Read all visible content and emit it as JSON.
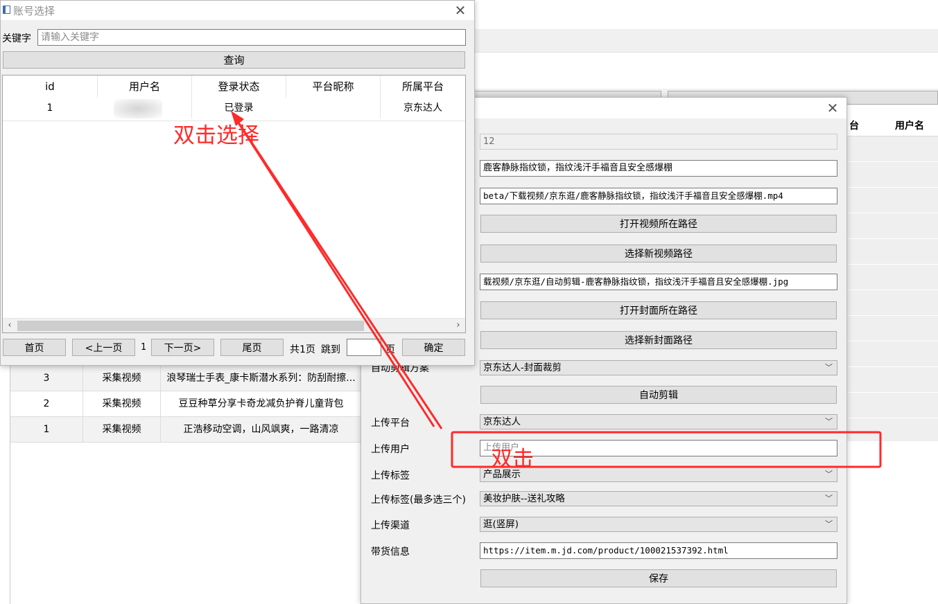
{
  "account_dialog": {
    "title": "账号选择",
    "keyword_label": "关键字",
    "keyword_placeholder": "请输入关键字",
    "query_button": "查询",
    "table_headers": [
      "id",
      "用户名",
      "登录状态",
      "平台昵称",
      "所属平台"
    ],
    "rows": [
      {
        "id": "1",
        "username": "",
        "login_status": "已登录",
        "nickname": "",
        "platform": "京东达人"
      }
    ],
    "pager": {
      "first": "首页",
      "prev": "<上一页",
      "current_page": "1",
      "next": "下一页>",
      "last": "尾页",
      "total": "共1页",
      "jump_to": "跳到",
      "page_unit": "页",
      "confirm": "确定"
    }
  },
  "background_table": {
    "header_partial": "台",
    "header_username": "用户名",
    "rows": [
      {
        "id": "3",
        "type": "采集视频",
        "title": "浪琴瑞士手表_康卡斯潜水系列：防刮耐擦..."
      },
      {
        "id": "2",
        "type": "采集视频",
        "title": "豆豆种草分享卡奇龙减负护脊儿童背包"
      },
      {
        "id": "1",
        "type": "采集视频",
        "title": "正浩移动空调，山风飒爽，一路清凉"
      }
    ]
  },
  "edit_dialog": {
    "id_value": "12",
    "title_value": "鹿客静脉指纹锁，指纹浅汗手福音且安全感爆棚",
    "video_path": "beta/下载视频/京东逛/鹿客静脉指纹锁，指纹浅汗手福音且安全感爆棚.mp4",
    "open_video_path_button": "打开视频所在路径",
    "select_video_path_button": "选择新视频路径",
    "cover_path": "载视频/京东逛/自动剪辑-鹿客静脉指纹锁，指纹浅汗手福音且安全感爆棚.jpg",
    "open_cover_path_button": "打开封面所在路径",
    "select_cover_path_button": "选择新封面路径",
    "auto_edit_scheme_label": "自动剪辑方案",
    "auto_edit_scheme_value": "京东达人-封面裁剪",
    "auto_edit_button": "自动剪辑",
    "upload_platform_label": "上传平台",
    "upload_platform_value": "京东达人",
    "upload_user_label": "上传用户",
    "upload_user_placeholder": "上传用户",
    "upload_tag_label": "上传标签",
    "upload_tag_value": "产品展示",
    "upload_tag3_label": "上传标签(最多选三个)",
    "upload_tag3_value": "美妆护肤--送礼攻略",
    "upload_channel_label": "上传渠道",
    "upload_channel_value": "逛(竖屏)",
    "goods_info_label": "带货信息",
    "goods_info_value": "https://item.m.jd.com/product/100021537392.html",
    "save_button": "保存"
  },
  "annotations": {
    "double_click_select": "双击选择",
    "double_click": "双击"
  },
  "colors": {
    "annotation": "#ff2a2a",
    "dialog_bg": "#f0f0f0",
    "button_bg": "#e1e1e1"
  }
}
